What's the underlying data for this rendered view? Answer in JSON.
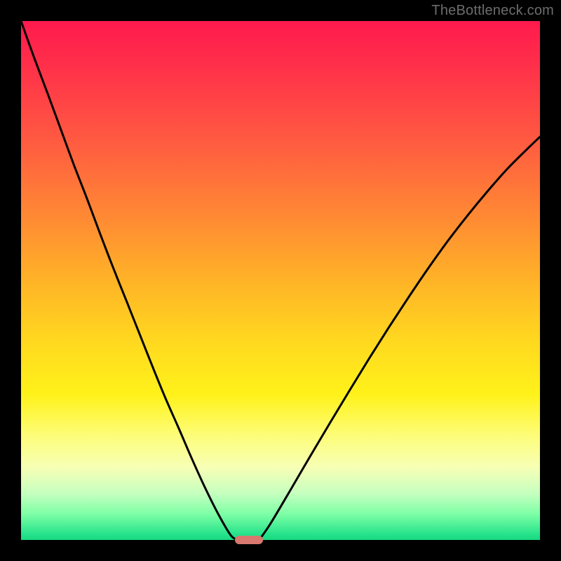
{
  "watermark": {
    "text": "TheBottleneck.com"
  },
  "chart_data": {
    "type": "line",
    "title": "",
    "xlabel": "",
    "ylabel": "",
    "xlim": [
      0,
      100
    ],
    "ylim": [
      0,
      100
    ],
    "grid": false,
    "legend": false,
    "series": [
      {
        "name": "curve-left",
        "x": [
          0.0,
          2.5,
          5.1,
          7.6,
          10.1,
          12.7,
          15.2,
          17.7,
          20.3,
          22.8,
          25.3,
          27.8,
          30.4,
          32.9,
          35.4,
          38.0,
          40.5,
          42.1
        ],
        "y": [
          100.0,
          93.0,
          86.1,
          79.3,
          72.5,
          65.8,
          59.1,
          52.6,
          46.1,
          39.8,
          33.5,
          27.4,
          21.5,
          15.7,
          10.2,
          5.0,
          0.8,
          0.0
        ]
      },
      {
        "name": "curve-right",
        "x": [
          45.9,
          48.1,
          51.9,
          55.7,
          59.5,
          63.3,
          67.1,
          70.9,
          74.7,
          78.5,
          82.3,
          86.1,
          89.9,
          93.7,
          97.5,
          100.0
        ],
        "y": [
          0.0,
          3.2,
          9.6,
          16.1,
          22.5,
          28.8,
          35.0,
          41.0,
          46.8,
          52.4,
          57.7,
          62.6,
          67.2,
          71.5,
          75.3,
          77.7
        ]
      }
    ],
    "marker": {
      "x_start": 41.2,
      "x_end": 46.6,
      "y": 0
    },
    "background_gradient": {
      "stops": [
        {
          "pos": 0.0,
          "color": "#ff1a4d"
        },
        {
          "pos": 0.5,
          "color": "#ffb327"
        },
        {
          "pos": 0.72,
          "color": "#fff21a"
        },
        {
          "pos": 0.95,
          "color": "#7dffa6"
        },
        {
          "pos": 1.0,
          "color": "#18d880"
        }
      ]
    }
  }
}
